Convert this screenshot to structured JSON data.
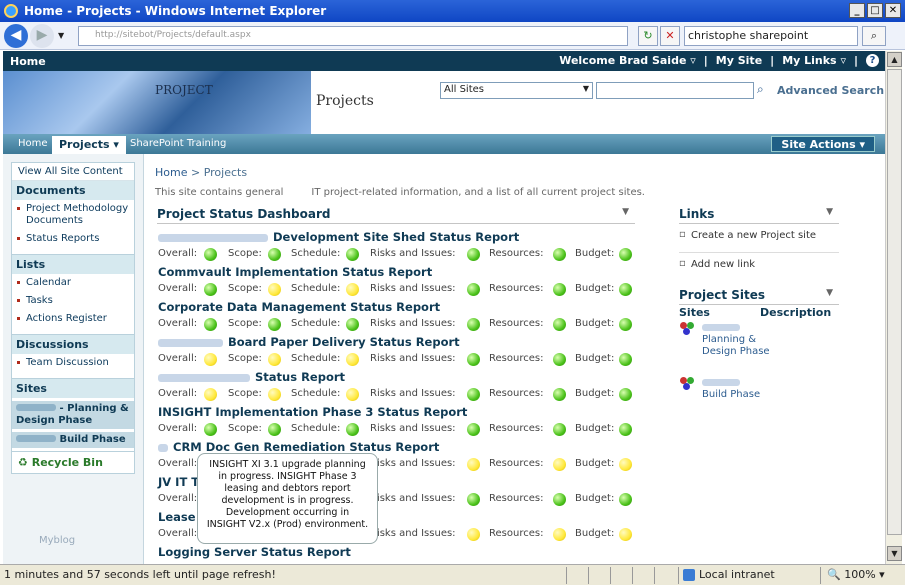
{
  "window": {
    "title": "Home - Projects - Windows Internet Explorer"
  },
  "browser": {
    "address": "http://sitebot/Projects/default.aspx",
    "search_value": "christophe sharepoint"
  },
  "topnav": {
    "home": "Home",
    "welcome": "Welcome Brad Saide",
    "my_site": "My Site",
    "my_links": "My Links"
  },
  "banner": {
    "project_label": "PROJECT",
    "site_title": "Projects",
    "scope": "All Sites",
    "advanced_search": "Advanced Search"
  },
  "tabs": [
    {
      "label": "Home"
    },
    {
      "label": "Projects ▾"
    },
    {
      "label": "SharePoint Training"
    }
  ],
  "site_actions": "Site Actions ▾",
  "quicklaunch": {
    "view_all": "View All Site Content",
    "documents": {
      "heading": "Documents",
      "items": [
        "Project Methodology Documents",
        "Status Reports"
      ]
    },
    "lists": {
      "heading": "Lists",
      "items": [
        "Calendar",
        "Tasks",
        "Actions Register"
      ]
    },
    "discussions": {
      "heading": "Discussions",
      "items": [
        "Team Discussion"
      ]
    },
    "sites": {
      "heading": "Sites",
      "items": [
        "- Planning & Design Phase",
        "Build Phase"
      ]
    },
    "recycle": "Recycle Bin",
    "myblog": "Myblog"
  },
  "breadcrumb": {
    "home": "Home",
    "sep": " > ",
    "current": "Projects"
  },
  "description": {
    "a": "This site contains general",
    "b": "IT project-related information, and a list of all current project sites."
  },
  "dashboard": {
    "title": "Project Status Dashboard",
    "labels": {
      "overall": "Overall:",
      "scope": "Scope:",
      "schedule": "Schedule:",
      "risks": "Risks and Issues:",
      "resources": "Resources:",
      "budget": "Budget:"
    },
    "reports": [
      {
        "title": "Development Site Shed Status Report",
        "blur": 110,
        "status": [
          "green",
          "green",
          "green",
          "green",
          "green",
          "green"
        ]
      },
      {
        "title": "Commvault Implementation Status Report",
        "blur": 0,
        "status": [
          "green",
          "yellow",
          "yellow",
          "green",
          "green",
          "green"
        ]
      },
      {
        "title": "Corporate Data Management Status Report",
        "blur": 0,
        "status": [
          "green",
          "green",
          "green",
          "green",
          "green",
          "green"
        ]
      },
      {
        "title": "Board Paper Delivery Status Report",
        "blur": 65,
        "status": [
          "yellow",
          "yellow",
          "yellow",
          "green",
          "green",
          "green"
        ]
      },
      {
        "title": "Status Report",
        "blur": 92,
        "status": [
          "yellow",
          "yellow",
          "yellow",
          "green",
          "green",
          "green"
        ]
      },
      {
        "title": "INSIGHT Implementation Phase 3 Status Report",
        "blur": 0,
        "status": [
          "green",
          "green",
          "green",
          "green",
          "green",
          "green"
        ]
      },
      {
        "title": "CRM Doc Gen Remediation Status Report",
        "blur": 10,
        "status": [
          "green",
          "yellow",
          "yellow",
          "yellow",
          "yellow",
          "yellow"
        ]
      },
      {
        "title": "JV IT T",
        "blur": 0,
        "status": [
          "green",
          "green",
          "green",
          "green",
          "green",
          "green"
        ]
      },
      {
        "title": "Lease C",
        "blur": 0,
        "status": [
          "green",
          "green",
          "green",
          "yellow",
          "yellow",
          "yellow"
        ]
      },
      {
        "title": "Logging Server Status Report",
        "blur": 0,
        "status": []
      }
    ]
  },
  "tooltip": "INSIGHT XI 3.1 upgrade planning in progress. INSIGHT Phase 3 leasing and debtors report development is in progress. Development occurring in INSIGHT V2.x (Prod) environment.",
  "links": {
    "title": "Links",
    "items": [
      "Create a new Project site",
      "Add new link"
    ]
  },
  "project_sites": {
    "title": "Project Sites",
    "col_sites": "Sites",
    "col_desc": "Description",
    "items": [
      {
        "label": "Planning & Design Phase"
      },
      {
        "label": "Build Phase"
      }
    ]
  },
  "statusbar": {
    "message": "1 minutes and 57 seconds left until page refresh!",
    "zone": "Local intranet",
    "zoom": "100%"
  }
}
